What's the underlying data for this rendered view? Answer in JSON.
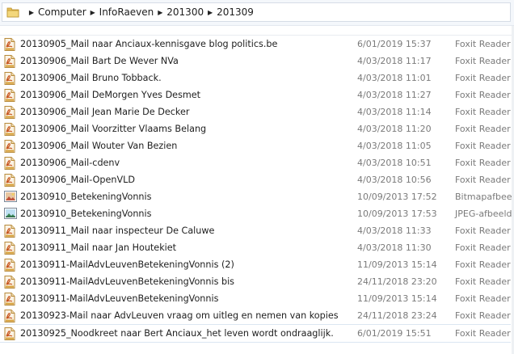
{
  "breadcrumb": [
    "Computer",
    "InfoRaeven",
    "201300",
    "201309"
  ],
  "files": [
    {
      "name": "20130905_Mail naar Anciaux-kennisgave blog politics.be",
      "date": "6/01/2019 15:37",
      "type": "Foxit Reader",
      "icon": "pdf"
    },
    {
      "name": "20130906_Mail Bart De Wever NVa",
      "date": "4/03/2018 11:17",
      "type": "Foxit Reader",
      "icon": "pdf"
    },
    {
      "name": "20130906_Mail Bruno Tobback.",
      "date": "4/03/2018 11:01",
      "type": "Foxit Reader",
      "icon": "pdf"
    },
    {
      "name": "20130906_Mail DeMorgen Yves Desmet",
      "date": "4/03/2018 11:27",
      "type": "Foxit Reader",
      "icon": "pdf"
    },
    {
      "name": "20130906_Mail Jean Marie De Decker",
      "date": "4/03/2018 11:14",
      "type": "Foxit Reader",
      "icon": "pdf"
    },
    {
      "name": "20130906_Mail Voorzitter Vlaams Belang",
      "date": "4/03/2018 11:20",
      "type": "Foxit Reader",
      "icon": "pdf"
    },
    {
      "name": "20130906_Mail Wouter Van Bezien",
      "date": "4/03/2018 11:05",
      "type": "Foxit Reader",
      "icon": "pdf"
    },
    {
      "name": "20130906_Mail-cdenv",
      "date": "4/03/2018 10:51",
      "type": "Foxit Reader",
      "icon": "pdf"
    },
    {
      "name": "20130906_Mail-OpenVLD",
      "date": "4/03/2018 10:56",
      "type": "Foxit Reader",
      "icon": "pdf"
    },
    {
      "name": "20130910_BetekeningVonnis",
      "date": "10/09/2013 17:52",
      "type": "Bitmapafbee",
      "icon": "bmp"
    },
    {
      "name": "20130910_BetekeningVonnis",
      "date": "10/09/2013 17:53",
      "type": "JPEG-afbeeld",
      "icon": "jpg"
    },
    {
      "name": "20130911_Mail naar inspecteur De Caluwe",
      "date": "4/03/2018 11:33",
      "type": "Foxit Reader",
      "icon": "pdf"
    },
    {
      "name": "20130911_Mail naar Jan Houtekiet",
      "date": "4/03/2018 11:30",
      "type": "Foxit Reader",
      "icon": "pdf"
    },
    {
      "name": "20130911-MailAdvLeuvenBetekeningVonnis (2)",
      "date": "11/09/2013 15:14",
      "type": "Foxit Reader",
      "icon": "pdf"
    },
    {
      "name": "20130911-MailAdvLeuvenBetekeningVonnis bis",
      "date": "24/11/2018 23:20",
      "type": "Foxit Reader",
      "icon": "pdf"
    },
    {
      "name": "20130911-MailAdvLeuvenBetekeningVonnis",
      "date": "11/09/2013 15:14",
      "type": "Foxit Reader",
      "icon": "pdf"
    },
    {
      "name": "20130923-Mail naar AdvLeuven vraag om uitleg en nemen van kopies",
      "date": "24/11/2018 23:24",
      "type": "Foxit Reader",
      "icon": "pdf"
    },
    {
      "name": "20130925_Noodkreet naar Bert Anciaux_het leven wordt ondraaglijk.",
      "date": "6/01/2019 15:51",
      "type": "Foxit Reader",
      "icon": "pdf"
    }
  ]
}
